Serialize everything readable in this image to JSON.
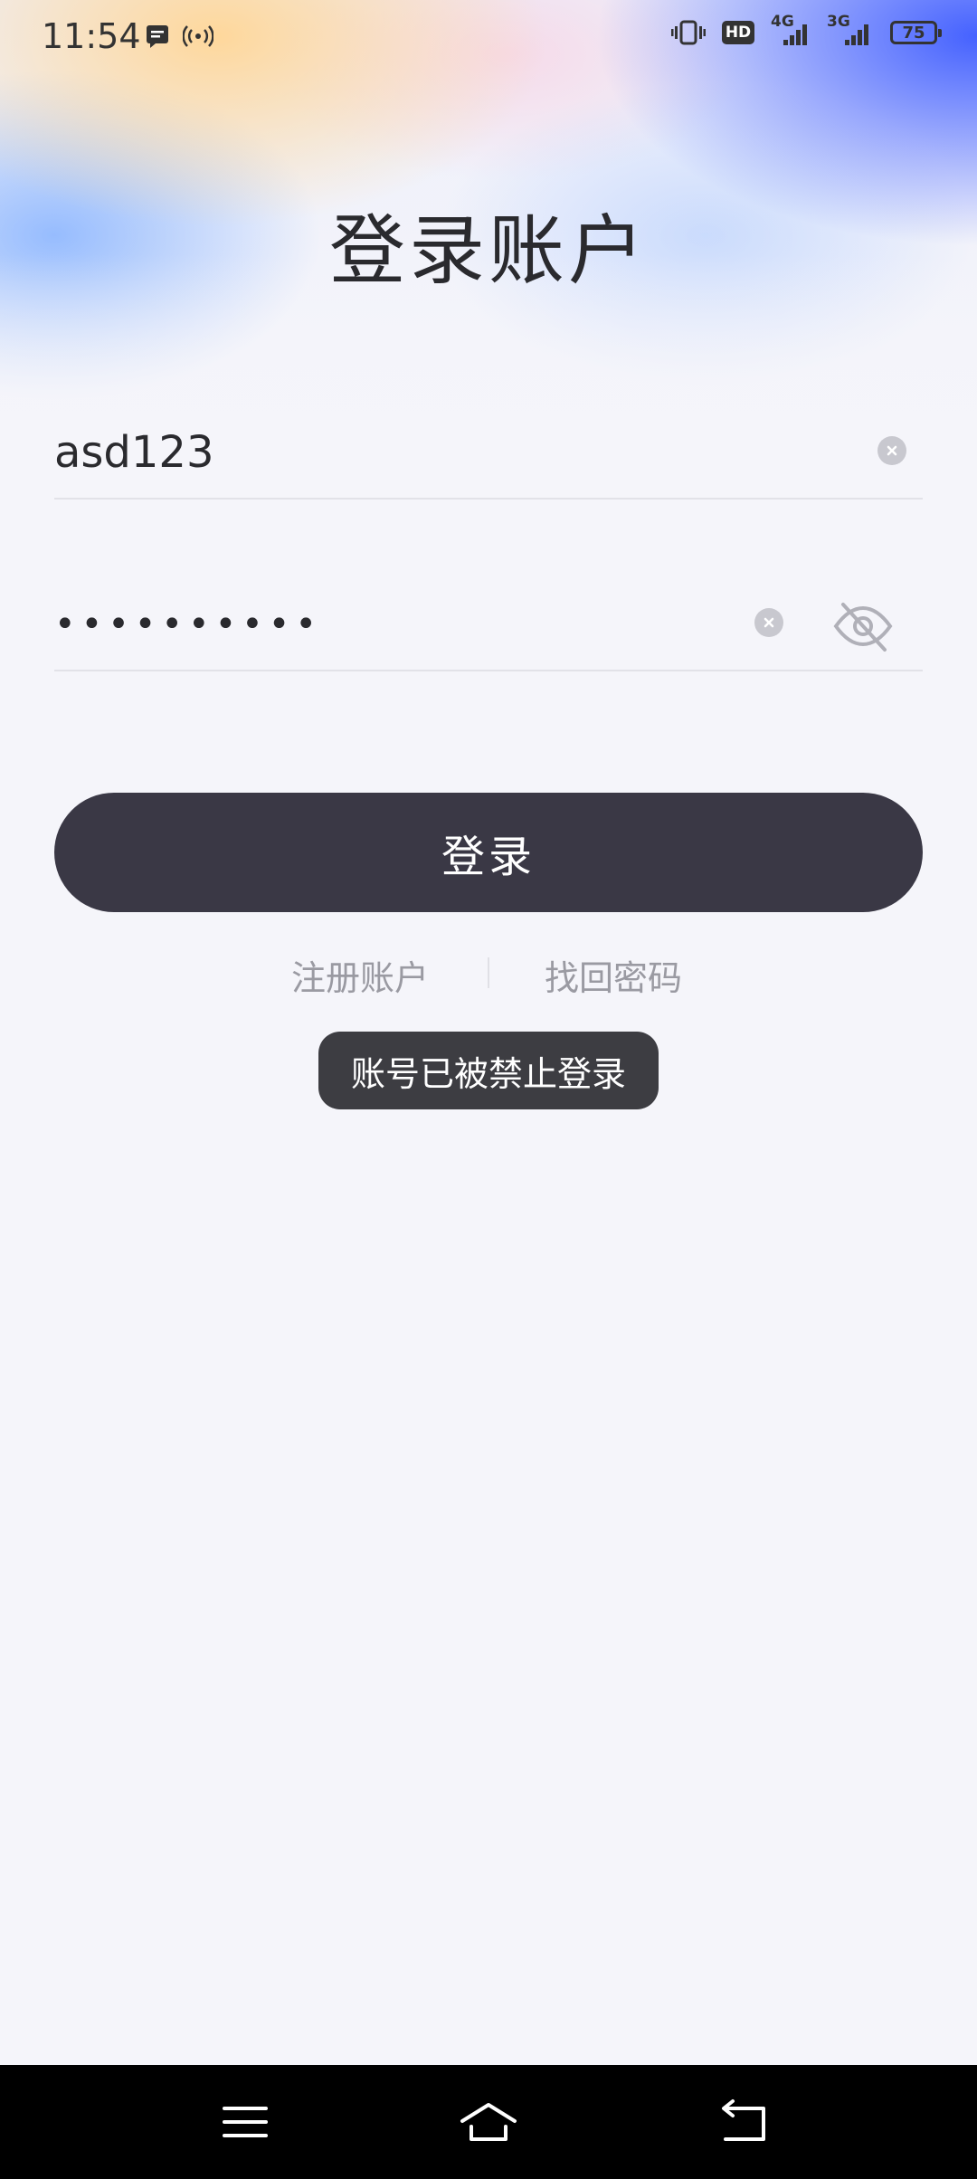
{
  "status_bar": {
    "time": "11:54",
    "network_hd": "HD",
    "network_4g": "4G",
    "network_3g": "3G",
    "battery": "75",
    "icons": [
      "message-icon",
      "hotspot-icon",
      "vibrate-icon",
      "hd-icon",
      "signal-4g-icon",
      "signal-3g-icon",
      "battery-icon"
    ]
  },
  "login": {
    "title": "登录账户",
    "username": {
      "value": "asd123"
    },
    "password": {
      "masked_value": "••••••••••"
    },
    "login_button_label": "登录",
    "register_link": "注册账户",
    "forgot_password_link": "找回密码"
  },
  "toast": {
    "message": "账号已被禁止登录"
  },
  "nav_bar": {
    "icons": [
      "menu-icon",
      "home-icon",
      "back-icon"
    ]
  },
  "colors": {
    "background": "#f5f5fa",
    "button": "#3a3845",
    "link": "#9a9aa2",
    "toast": "#3d3d42",
    "nav_bar": "#000000"
  }
}
